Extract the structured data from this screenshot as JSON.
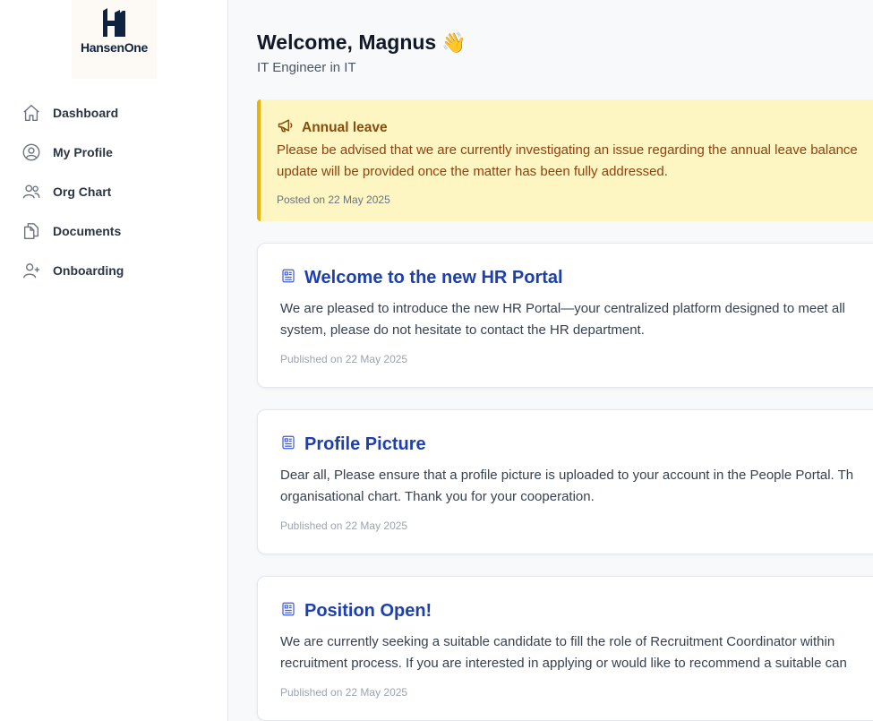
{
  "brand": {
    "logo_text": "HansenOne"
  },
  "sidebar": {
    "items": [
      {
        "label": "Dashboard",
        "icon": "home-icon"
      },
      {
        "label": "My Profile",
        "icon": "user-circle-icon"
      },
      {
        "label": "Org Chart",
        "icon": "users-icon"
      },
      {
        "label": "Documents",
        "icon": "documents-icon"
      },
      {
        "label": "Onboarding",
        "icon": "user-plus-icon"
      }
    ]
  },
  "header": {
    "welcome": "Welcome, Magnus",
    "wave_emoji": "👋",
    "subtitle": "IT Engineer in IT"
  },
  "alert": {
    "icon": "megaphone-icon",
    "title": "Annual leave",
    "body_line1": "Please be advised that we are currently investigating an issue regarding the annual leave balance",
    "body_line2": "update will be provided once the matter has been fully addressed.",
    "date": "Posted on 22 May 2025",
    "colors": {
      "background": "#fdf6c3",
      "border": "#eab308",
      "text": "#854d0e"
    }
  },
  "posts": [
    {
      "icon": "newspaper-icon",
      "title": "Welcome to the new HR Portal",
      "body_line1": "We are pleased to introduce the new HR Portal—your centralized platform designed to meet all",
      "body_line2": "system, please do not hesitate to contact the HR department.",
      "date": "Published on 22 May 2025"
    },
    {
      "icon": "newspaper-icon",
      "title": "Profile Picture",
      "body_line1": "Dear all, Please ensure that a profile picture is uploaded to your account in the People Portal. Th",
      "body_line2": "organisational chart. Thank you for your cooperation.",
      "date": "Published on 22 May 2025"
    },
    {
      "icon": "newspaper-icon",
      "title": "Position Open!",
      "body_line1": "We are currently seeking a suitable candidate to fill the role of Recruitment Coordinator within",
      "body_line2": "recruitment process. If you are interested in applying or would like to recommend a suitable can",
      "date": "Published on 22 May 2025"
    }
  ],
  "colors": {
    "accent": "#1e40af",
    "sidebar_text": "#2b3544",
    "brand_navy": "#0f2340"
  }
}
